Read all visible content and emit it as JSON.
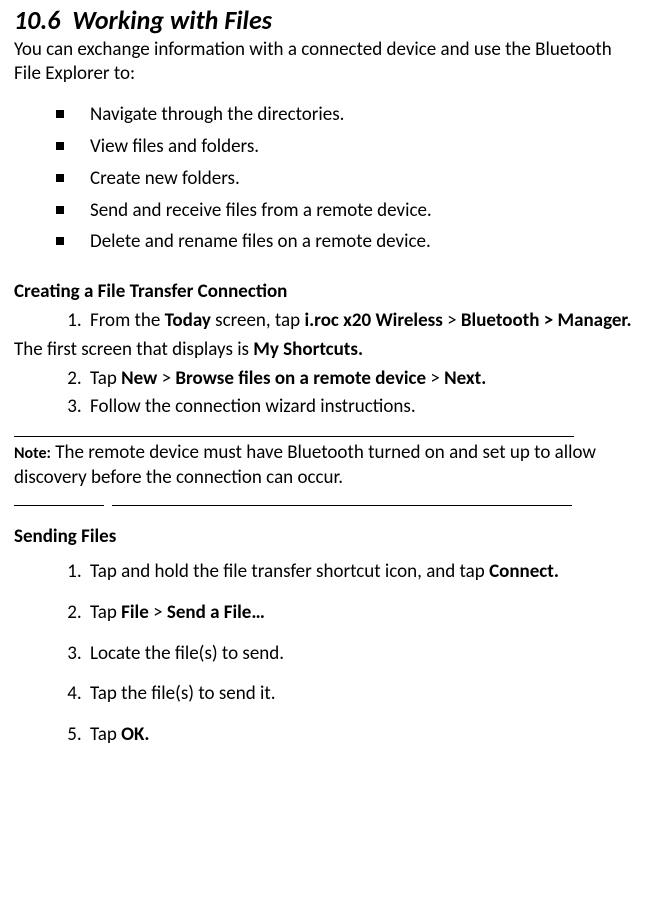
{
  "section": {
    "number": "10.6",
    "title": "Working with Files"
  },
  "intro": "You can exchange information with a connected device and use the Bluetooth File Explorer to:",
  "capabilities": [
    "Navigate through the directories.",
    "View files and folders.",
    "Create new folders.",
    "Send and receive files from a remote device.",
    "Delete and rename files on a remote device."
  ],
  "create_conn": {
    "heading": "Creating a File Transfer Connection",
    "step1_a": "From the ",
    "step1_b": "Today",
    "step1_c": " screen, tap ",
    "step1_d": "i.roc x20 Wireless",
    "step1_e": " > ",
    "step1_f": "Bluetooth > Manager.",
    "inter_a": "The first screen that displays is ",
    "inter_b": "My Shortcuts.",
    "step2_a": "Tap ",
    "step2_b": "New",
    "step2_c": " > ",
    "step2_d": "Browse files on a remote device",
    "step2_e": " > ",
    "step2_f": "Next.",
    "step3": "Follow the connection wizard instructions."
  },
  "note": {
    "label": "Note:",
    "text": " The remote device must have Bluetooth turned on and set up to allow discovery before the connection can occur."
  },
  "sending": {
    "heading": "Sending Files",
    "step1_a": "Tap and hold the file transfer shortcut icon, and tap ",
    "step1_b": "Connect.",
    "step2_a": "Tap ",
    "step2_b": "File",
    "step2_c": " > ",
    "step2_d": "Send a File…",
    "step3": "Locate the file(s) to send.",
    "step4": "Tap the file(s) to send it.",
    "step5_a": "Tap ",
    "step5_b": "OK."
  }
}
